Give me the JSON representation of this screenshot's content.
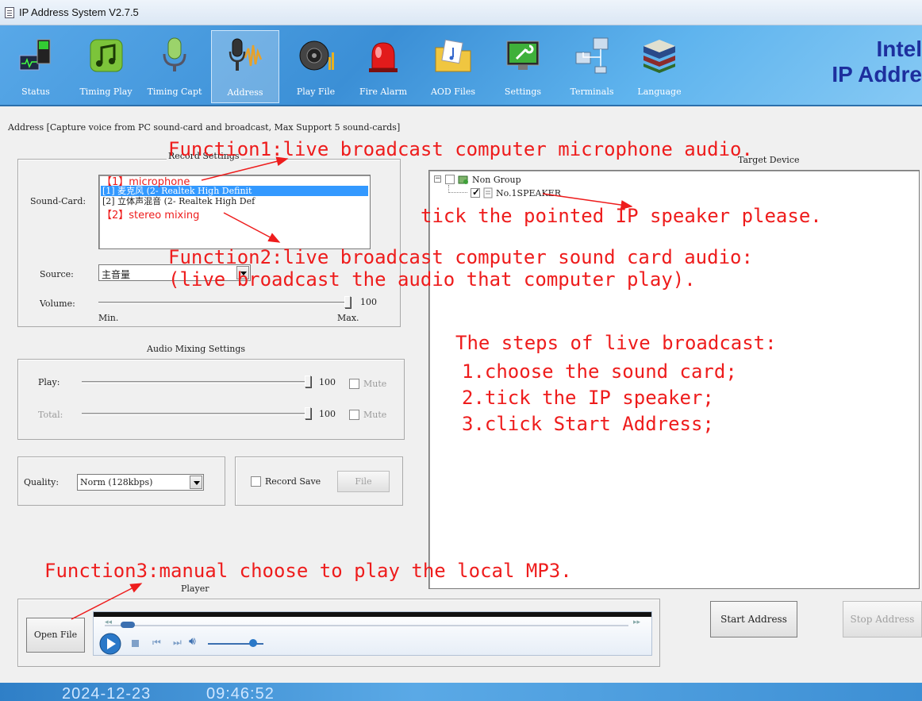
{
  "window": {
    "title": "IP Address System V2.7.5"
  },
  "toolbar": {
    "items": [
      {
        "label": "Status",
        "icon": "monitor-status-icon"
      },
      {
        "label": "Timing Play",
        "icon": "music-note-icon"
      },
      {
        "label": "Timing Capt",
        "icon": "microphone-icon"
      },
      {
        "label": "Address",
        "icon": "microphone-waveform-icon"
      },
      {
        "label": "Play File",
        "icon": "speaker-icon"
      },
      {
        "label": "Fire Alarm",
        "icon": "alarm-light-icon"
      },
      {
        "label": "AOD Files",
        "icon": "folder-music-icon"
      },
      {
        "label": "Settings",
        "icon": "settings-wrench-icon"
      },
      {
        "label": "Terminals",
        "icon": "network-terminals-icon"
      },
      {
        "label": "Language",
        "icon": "books-icon"
      }
    ],
    "brand_line1": "Intel",
    "brand_line2": "IP Addre"
  },
  "address": {
    "description": "Address  [Capture voice from PC sound-card and broadcast, Max Support 5 sound-cards]"
  },
  "record": {
    "title": "Record Settings",
    "soundcard_label": "Sound-Card:",
    "soundcards": [
      "[1] 麦克风 (2- Realtek High Definit",
      "[2] 立体声混音 (2- Realtek High Def"
    ],
    "source_label": "Source:",
    "source_value": "主音量",
    "volume_label": "Volume:",
    "volume_value": "100",
    "volume_level": 1.0,
    "min_label": "Min.",
    "max_label": "Max."
  },
  "mixing": {
    "title": "Audio Mixing Settings",
    "play_label": "Play:",
    "play_value": "100",
    "total_label": "Total:",
    "total_value": "100",
    "mute_label": "Mute"
  },
  "quality": {
    "label": "Quality:",
    "value": "Norm (128kbps)",
    "record_save_label": "Record Save",
    "file_button": "File"
  },
  "target": {
    "title": "Target Device",
    "group": "Non Group",
    "device": "No.1SPEAKER"
  },
  "player": {
    "title": "Player",
    "open_file": "Open File"
  },
  "actions": {
    "start": "Start Address",
    "stop": "Stop Address"
  },
  "status": {
    "date": "2024-12-23",
    "time": "09:46:52"
  },
  "annotations": {
    "function1": "Function1:live broadcast computer microphone audio.",
    "microphone_tag": "【1】microphone",
    "stereo_tag": "【2】stereo mixing",
    "tick_speaker": "tick the pointed IP speaker please.",
    "function2_line1": "Function2:live broadcast computer sound card audio:",
    "function2_line2": "(live broadcast the audio that computer play).",
    "steps_title": "The steps of live broadcast:",
    "step1": "1.choose the sound card;",
    "step2": "2.tick the IP speaker;",
    "step3": "3.click Start Address;",
    "function3": "Function3:manual choose to play the local MP3."
  },
  "colors": {
    "annotation_red": "#ee1c1c",
    "toolbar_blue": "#3b8fd6",
    "selection_blue": "#3399ff",
    "brand_navy": "#1d2f9e"
  }
}
